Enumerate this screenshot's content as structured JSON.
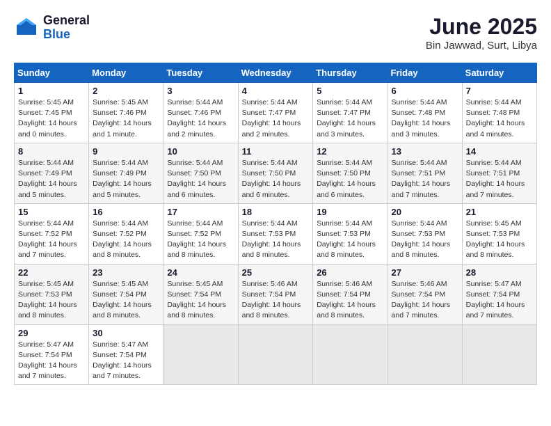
{
  "header": {
    "logo_general": "General",
    "logo_blue": "Blue",
    "month_title": "June 2025",
    "location": "Bin Jawwad, Surt, Libya"
  },
  "weekdays": [
    "Sunday",
    "Monday",
    "Tuesday",
    "Wednesday",
    "Thursday",
    "Friday",
    "Saturday"
  ],
  "weeks": [
    [
      {
        "day": "1",
        "info": "Sunrise: 5:45 AM\nSunset: 7:45 PM\nDaylight: 14 hours\nand 0 minutes."
      },
      {
        "day": "2",
        "info": "Sunrise: 5:45 AM\nSunset: 7:46 PM\nDaylight: 14 hours\nand 1 minute."
      },
      {
        "day": "3",
        "info": "Sunrise: 5:44 AM\nSunset: 7:46 PM\nDaylight: 14 hours\nand 2 minutes."
      },
      {
        "day": "4",
        "info": "Sunrise: 5:44 AM\nSunset: 7:47 PM\nDaylight: 14 hours\nand 2 minutes."
      },
      {
        "day": "5",
        "info": "Sunrise: 5:44 AM\nSunset: 7:47 PM\nDaylight: 14 hours\nand 3 minutes."
      },
      {
        "day": "6",
        "info": "Sunrise: 5:44 AM\nSunset: 7:48 PM\nDaylight: 14 hours\nand 3 minutes."
      },
      {
        "day": "7",
        "info": "Sunrise: 5:44 AM\nSunset: 7:48 PM\nDaylight: 14 hours\nand 4 minutes."
      }
    ],
    [
      {
        "day": "8",
        "info": "Sunrise: 5:44 AM\nSunset: 7:49 PM\nDaylight: 14 hours\nand 5 minutes."
      },
      {
        "day": "9",
        "info": "Sunrise: 5:44 AM\nSunset: 7:49 PM\nDaylight: 14 hours\nand 5 minutes."
      },
      {
        "day": "10",
        "info": "Sunrise: 5:44 AM\nSunset: 7:50 PM\nDaylight: 14 hours\nand 6 minutes."
      },
      {
        "day": "11",
        "info": "Sunrise: 5:44 AM\nSunset: 7:50 PM\nDaylight: 14 hours\nand 6 minutes."
      },
      {
        "day": "12",
        "info": "Sunrise: 5:44 AM\nSunset: 7:50 PM\nDaylight: 14 hours\nand 6 minutes."
      },
      {
        "day": "13",
        "info": "Sunrise: 5:44 AM\nSunset: 7:51 PM\nDaylight: 14 hours\nand 7 minutes."
      },
      {
        "day": "14",
        "info": "Sunrise: 5:44 AM\nSunset: 7:51 PM\nDaylight: 14 hours\nand 7 minutes."
      }
    ],
    [
      {
        "day": "15",
        "info": "Sunrise: 5:44 AM\nSunset: 7:52 PM\nDaylight: 14 hours\nand 7 minutes."
      },
      {
        "day": "16",
        "info": "Sunrise: 5:44 AM\nSunset: 7:52 PM\nDaylight: 14 hours\nand 8 minutes."
      },
      {
        "day": "17",
        "info": "Sunrise: 5:44 AM\nSunset: 7:52 PM\nDaylight: 14 hours\nand 8 minutes."
      },
      {
        "day": "18",
        "info": "Sunrise: 5:44 AM\nSunset: 7:53 PM\nDaylight: 14 hours\nand 8 minutes."
      },
      {
        "day": "19",
        "info": "Sunrise: 5:44 AM\nSunset: 7:53 PM\nDaylight: 14 hours\nand 8 minutes."
      },
      {
        "day": "20",
        "info": "Sunrise: 5:44 AM\nSunset: 7:53 PM\nDaylight: 14 hours\nand 8 minutes."
      },
      {
        "day": "21",
        "info": "Sunrise: 5:45 AM\nSunset: 7:53 PM\nDaylight: 14 hours\nand 8 minutes."
      }
    ],
    [
      {
        "day": "22",
        "info": "Sunrise: 5:45 AM\nSunset: 7:53 PM\nDaylight: 14 hours\nand 8 minutes."
      },
      {
        "day": "23",
        "info": "Sunrise: 5:45 AM\nSunset: 7:54 PM\nDaylight: 14 hours\nand 8 minutes."
      },
      {
        "day": "24",
        "info": "Sunrise: 5:45 AM\nSunset: 7:54 PM\nDaylight: 14 hours\nand 8 minutes."
      },
      {
        "day": "25",
        "info": "Sunrise: 5:46 AM\nSunset: 7:54 PM\nDaylight: 14 hours\nand 8 minutes."
      },
      {
        "day": "26",
        "info": "Sunrise: 5:46 AM\nSunset: 7:54 PM\nDaylight: 14 hours\nand 8 minutes."
      },
      {
        "day": "27",
        "info": "Sunrise: 5:46 AM\nSunset: 7:54 PM\nDaylight: 14 hours\nand 7 minutes."
      },
      {
        "day": "28",
        "info": "Sunrise: 5:47 AM\nSunset: 7:54 PM\nDaylight: 14 hours\nand 7 minutes."
      }
    ],
    [
      {
        "day": "29",
        "info": "Sunrise: 5:47 AM\nSunset: 7:54 PM\nDaylight: 14 hours\nand 7 minutes."
      },
      {
        "day": "30",
        "info": "Sunrise: 5:47 AM\nSunset: 7:54 PM\nDaylight: 14 hours\nand 7 minutes."
      },
      {
        "day": "",
        "info": ""
      },
      {
        "day": "",
        "info": ""
      },
      {
        "day": "",
        "info": ""
      },
      {
        "day": "",
        "info": ""
      },
      {
        "day": "",
        "info": ""
      }
    ]
  ]
}
